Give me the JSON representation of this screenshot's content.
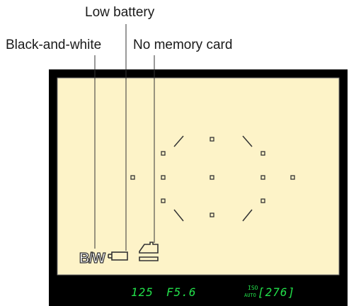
{
  "callouts": {
    "low_battery": "Low battery",
    "black_and_white": "Black-and-white",
    "no_memory_card": "No memory card"
  },
  "viewfinder": {
    "bw_indicator": "B/W",
    "shutter_speed": "125",
    "aperture": "F5.6",
    "iso_label_top": "ISO",
    "iso_label_bottom": "AUTO",
    "shots_remaining": "[276]"
  },
  "colors": {
    "screen": "#fdf3c8",
    "frame": "#000000",
    "lcd_green": "#22e04a",
    "af_point": "#333333"
  },
  "icons": [
    "battery-low-icon",
    "no-memory-card-icon"
  ]
}
